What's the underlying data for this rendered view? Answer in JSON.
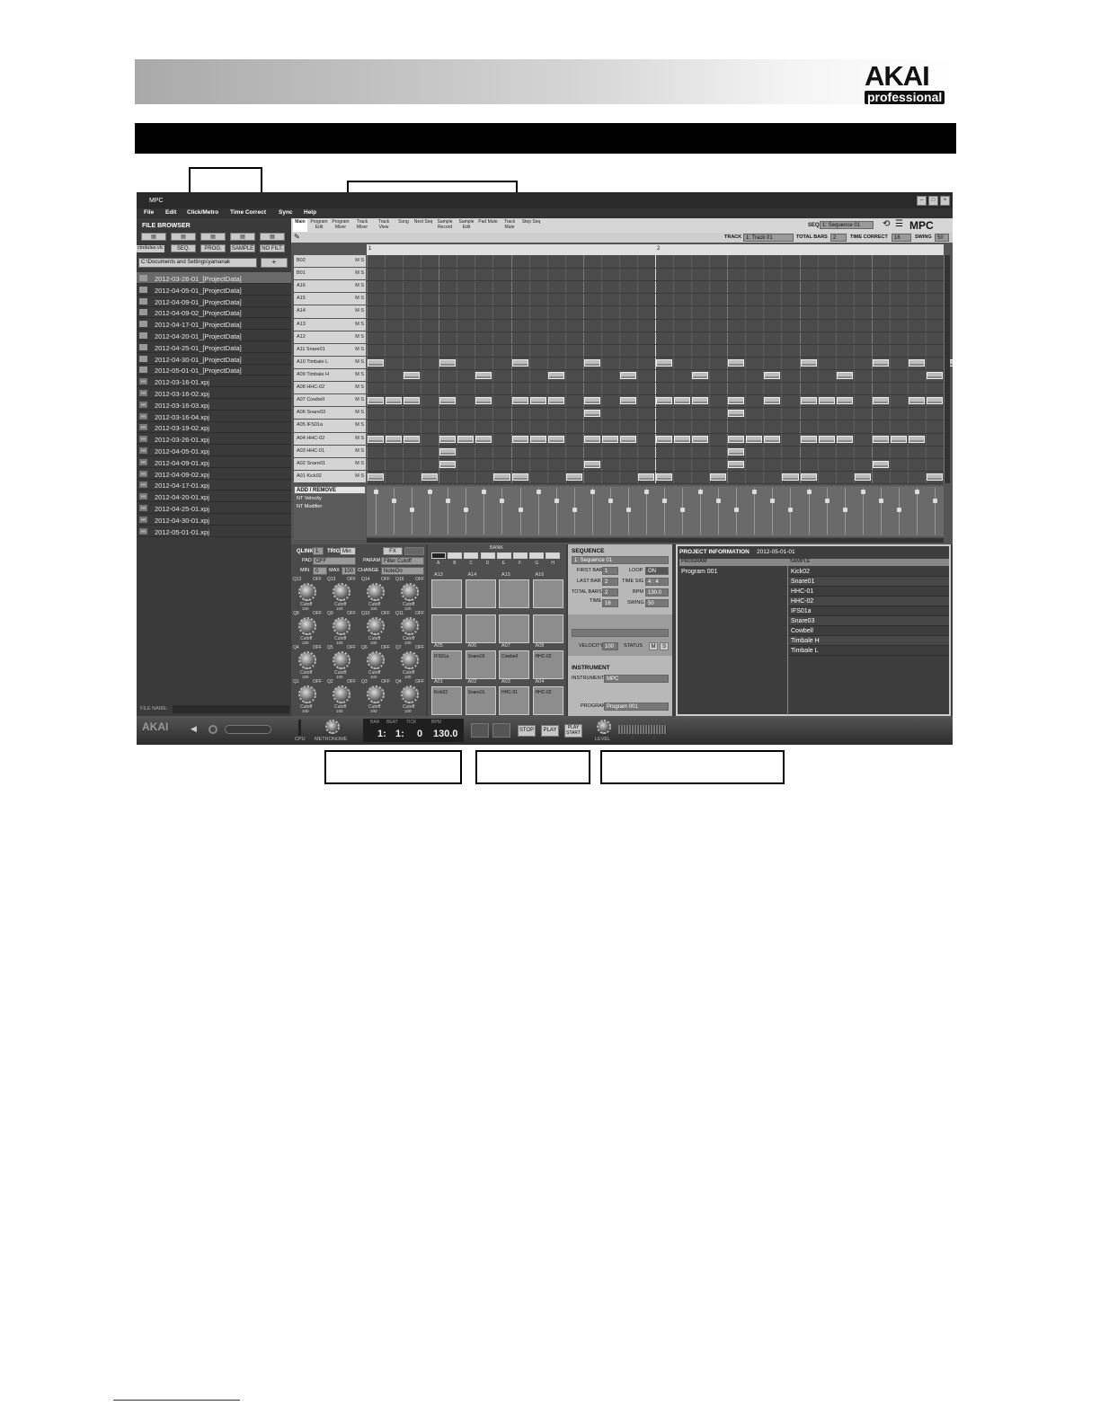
{
  "logo": {
    "brand": "AKAI",
    "sub": "professional"
  },
  "window": {
    "title": "MPC",
    "menu": [
      "File",
      "Edit",
      "Click/Metro",
      "Time Correct",
      "Sync",
      "Help"
    ]
  },
  "tabs": [
    "Main",
    "Program Edit",
    "Program Mixer",
    "Track Mixer",
    "Track View",
    "Song",
    "Next Seq",
    "Sample Record",
    "Sample Edit",
    "Pad Mute",
    "Track Mute",
    "Step Seq"
  ],
  "topright": {
    "seq_label": "SEQ",
    "seq_value": "1: Sequence 01",
    "brand": "MPC",
    "track_label": "TRACK",
    "track_value": "1: Track 01",
    "total_bars_label": "TOTAL BARS",
    "total_bars": "2",
    "tc_label": "TIME CORRECT",
    "tc_value": "16",
    "swing_label": "SWING",
    "swing_value": "50"
  },
  "browser": {
    "title": "FILE BROWSER",
    "filters": [
      "SEQ.",
      "PROG.",
      "SAMPLE",
      "NO FILT."
    ],
    "left_tag": "ctodulas.vlc",
    "path": "C:\\Documents and Settings\\yamanak",
    "add": "+",
    "file_name_label": "FILE NAME:",
    "items": [
      {
        "type": "folder",
        "name": "2012-03-26-01_[ProjectData]"
      },
      {
        "type": "folder",
        "name": "2012-04-05-01_[ProjectData]"
      },
      {
        "type": "folder",
        "name": "2012-04-09-01_[ProjectData]"
      },
      {
        "type": "folder",
        "name": "2012-04-09-02_[ProjectData]"
      },
      {
        "type": "folder",
        "name": "2012-04-17-01_[ProjectData]"
      },
      {
        "type": "folder",
        "name": "2012-04-20-01_[ProjectData]"
      },
      {
        "type": "folder",
        "name": "2012-04-25-01_[ProjectData]"
      },
      {
        "type": "folder",
        "name": "2012-04-30-01_[ProjectData]"
      },
      {
        "type": "folder",
        "name": "2012-05-01-01_[ProjectData]"
      },
      {
        "type": "file",
        "name": "2012-03-16-01.xpj"
      },
      {
        "type": "file",
        "name": "2012-03-16-02.xpj"
      },
      {
        "type": "file",
        "name": "2012-03-16-03.xpj"
      },
      {
        "type": "file",
        "name": "2012-03-16-04.xpj"
      },
      {
        "type": "file",
        "name": "2012-03-19-02.xpj"
      },
      {
        "type": "file",
        "name": "2012-03-26-01.xpj"
      },
      {
        "type": "file",
        "name": "2012-04-05-01.xpj"
      },
      {
        "type": "file",
        "name": "2012-04-09-01.xpj"
      },
      {
        "type": "file",
        "name": "2012-04-09-02.xpj"
      },
      {
        "type": "file",
        "name": "2012-04-17-01.xpj"
      },
      {
        "type": "file",
        "name": "2012-04-20-01.xpj"
      },
      {
        "type": "file",
        "name": "2012-04-25-01.xpj"
      },
      {
        "type": "file",
        "name": "2012-04-30-01.xpj"
      },
      {
        "type": "file",
        "name": "2012-05-01-01.xpj"
      }
    ]
  },
  "grid": {
    "bar1": "1",
    "bar2": "2",
    "lanes": [
      "B02",
      "B01",
      "A16",
      "A15",
      "A14",
      "A13",
      "A12",
      "A11 Snare01",
      "A10 Timbale L",
      "A09 Timbale H",
      "A08 HHC-02",
      "A07 Cowbell",
      "A06 Snare03",
      "A05 IFS01a",
      "A04 HHC-02",
      "A03 HHC-01",
      "A02 Snare01",
      "A01 Kick02"
    ],
    "ms": "M S",
    "notes": [
      [],
      [],
      [],
      [],
      [],
      [],
      [],
      [],
      [
        0,
        4,
        8,
        12,
        16,
        20,
        24,
        28,
        30,
        32
      ],
      [
        2,
        6,
        10,
        14,
        18,
        22,
        26,
        31
      ],
      [],
      [
        0,
        1,
        2,
        4,
        6,
        8,
        9,
        10,
        12,
        14,
        16,
        17,
        18,
        20,
        22,
        24,
        25,
        26,
        28,
        30,
        31
      ],
      [
        12,
        20
      ],
      [],
      [
        0,
        1,
        2,
        4,
        5,
        6,
        8,
        9,
        10,
        12,
        13,
        14,
        16,
        17,
        18,
        20,
        21,
        22,
        24,
        25,
        26,
        28,
        29,
        30
      ],
      [
        4,
        20
      ],
      [
        4,
        12,
        20,
        28
      ],
      [
        0,
        3,
        7,
        8,
        11,
        15,
        16,
        19,
        23,
        24,
        27,
        31
      ]
    ],
    "add_remove": "ADD / REMOVE",
    "params": [
      "NT Velocity",
      "NT Modifier"
    ]
  },
  "qlink": {
    "label": "QLINK",
    "value": "1",
    "trig_label": "TRIG",
    "trig_value": "Min",
    "pad_label": "PAD",
    "pad_value": "OFF",
    "param_label": "PARAM",
    "param_value": "Filter Cutoff",
    "min_label": "MIN",
    "min_value": "0",
    "max_label": "MAX",
    "max_value": "100",
    "change_label": "CHANGE",
    "change_value": "NoteOn",
    "fx": "FX",
    "knobs": [
      {
        "id": "Q12",
        "state": "OFF",
        "p": "Cutoff",
        "v": "100"
      },
      {
        "id": "Q13",
        "state": "OFF",
        "p": "Cutoff",
        "v": "100"
      },
      {
        "id": "Q14",
        "state": "OFF",
        "p": "Cutoff",
        "v": "100"
      },
      {
        "id": "Q16",
        "state": "OFF",
        "p": "Cutoff",
        "v": "100"
      },
      {
        "id": "Q8",
        "state": "OFF",
        "p": "Cutoff",
        "v": "100"
      },
      {
        "id": "Q9",
        "state": "OFF",
        "p": "Cutoff",
        "v": "100"
      },
      {
        "id": "Q10",
        "state": "OFF",
        "p": "Cutoff",
        "v": "100"
      },
      {
        "id": "Q11",
        "state": "OFF",
        "p": "Cutoff",
        "v": "100"
      },
      {
        "id": "Q4",
        "state": "OFF",
        "p": "Cutoff",
        "v": "100"
      },
      {
        "id": "Q5",
        "state": "OFF",
        "p": "Cutoff",
        "v": "100"
      },
      {
        "id": "Q6",
        "state": "OFF",
        "p": "Cutoff",
        "v": "100"
      },
      {
        "id": "Q7",
        "state": "OFF",
        "p": "Cutoff",
        "v": "100"
      },
      {
        "id": "Q1",
        "state": "OFF",
        "p": "Cutoff",
        "v": "100"
      },
      {
        "id": "Q2",
        "state": "OFF",
        "p": "Cutoff",
        "v": "100"
      },
      {
        "id": "Q3",
        "state": "OFF",
        "p": "Cutoff",
        "v": "100"
      },
      {
        "id": "Q4",
        "state": "OFF",
        "p": "Cutoff",
        "v": "100"
      }
    ]
  },
  "pads": {
    "bank_label": "BANK",
    "banks": [
      "A",
      "B",
      "C",
      "D",
      "E",
      "F",
      "G",
      "H"
    ],
    "row1": [
      {
        "id": "A13",
        "s": ""
      },
      {
        "id": "A14",
        "s": ""
      },
      {
        "id": "A15",
        "s": ""
      },
      {
        "id": "A16",
        "s": ""
      }
    ],
    "row3": [
      {
        "id": "A05",
        "s": "IFS01a"
      },
      {
        "id": "A06",
        "s": "Snare03"
      },
      {
        "id": "A07",
        "s": "Cowbell"
      },
      {
        "id": "A08",
        "s": "HHC-02"
      }
    ],
    "row4": [
      {
        "id": "A01",
        "s": "Kick02"
      },
      {
        "id": "A02",
        "s": "Snare01"
      },
      {
        "id": "A03",
        "s": "HHC-01"
      },
      {
        "id": "A04",
        "s": "HHC-02"
      }
    ]
  },
  "sequence": {
    "title": "SEQUENCE",
    "seq": "1: Sequence 01",
    "first_bar_label": "FIRST BAR",
    "first_bar": "1",
    "loop_label": "LOOP",
    "loop": "ON",
    "last_bar_label": "LAST BAR",
    "last_bar": "2",
    "time_sig_label": "TIME SIG",
    "time_sig": "4 : 4",
    "total_bars_label": "TOTAL BARS",
    "total_bars": "2",
    "bpm_label": "BPM",
    "bpm": "130.0",
    "time_label": "TIME",
    "time_value": "16",
    "swing_label": "SWING",
    "swing": "50",
    "velocity_label": "VELOCITY",
    "velocity": "100",
    "status_label": "STATUS",
    "m": "M",
    "s": "S"
  },
  "instrument": {
    "title": "INSTRUMENT",
    "inst_label": "INSTRUMENT",
    "inst": "MPC",
    "prog_label": "PROGRAM",
    "prog": "Program 001"
  },
  "project": {
    "title": "PROJECT INFORMATION",
    "date": "2012-05-01-01",
    "program_header": "PROGRAM",
    "sample_header": "SAMPLE",
    "program": "Program 001",
    "samples": [
      "Kick02",
      "Snare01",
      "HHC-01",
      "HHC-02",
      "IFS01a",
      "Snare03",
      "Cowbell",
      "Timbale H",
      "Timbale L"
    ]
  },
  "transport": {
    "brand": "AKAI",
    "cpu_label": "CPU",
    "metro_label": "METRONOME",
    "bar_label": "BAR",
    "beat_label": "BEAT",
    "tick_label": "TICK",
    "bpm_label": "BPM",
    "bar": "1:",
    "beat": "1:",
    "tick": "0",
    "bpm": "130.0",
    "stop": "STOP",
    "play": "PLAY",
    "play_start": "PLAY START",
    "level_label": "LEVEL"
  }
}
